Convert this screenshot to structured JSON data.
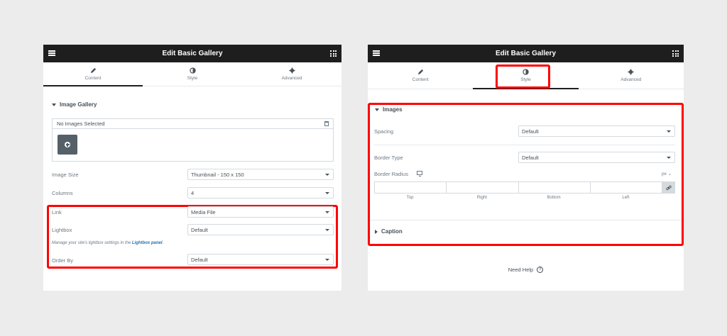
{
  "left_panel": {
    "title": "Edit Basic Gallery",
    "tabs": [
      {
        "label": "Content",
        "icon": "pencil-icon",
        "active": true
      },
      {
        "label": "Style",
        "icon": "contrast-icon",
        "active": false
      },
      {
        "label": "Advanced",
        "icon": "gear-icon",
        "active": false
      }
    ],
    "section_title": "Image Gallery",
    "gallery_status": "No Images Selected",
    "fields": {
      "image_size": {
        "label": "Image Size",
        "value": "Thumbnail - 150 x 150"
      },
      "columns": {
        "label": "Columns",
        "value": "4"
      },
      "link": {
        "label": "Link",
        "value": "Media File"
      },
      "lightbox": {
        "label": "Lightbox",
        "value": "Default"
      },
      "order_by": {
        "label": "Order By",
        "value": "Default"
      }
    },
    "lightbox_note": "Manage your site's lightbox settings in the",
    "lightbox_link": "Lightbox panel",
    "lightbox_note_end": "."
  },
  "right_panel": {
    "title": "Edit Basic Gallery",
    "tabs": [
      {
        "label": "Content",
        "icon": "pencil-icon",
        "active": false
      },
      {
        "label": "Style",
        "icon": "contrast-icon",
        "active": true
      },
      {
        "label": "Advanced",
        "icon": "gear-icon",
        "active": false
      }
    ],
    "images_section": "Images",
    "spacing": {
      "label": "Spacing",
      "value": "Default"
    },
    "border_type": {
      "label": "Border Type",
      "value": "Default"
    },
    "border_radius": {
      "label": "Border Radius",
      "unit": "px"
    },
    "dimension_labels": [
      "Top",
      "Right",
      "Bottom",
      "Left"
    ],
    "caption_section": "Caption",
    "help_text": "Need Help",
    "help_icon": "?"
  },
  "colors": {
    "highlight": "#ff0000",
    "header_bg": "#1e1e1e",
    "link": "#2271b1"
  }
}
